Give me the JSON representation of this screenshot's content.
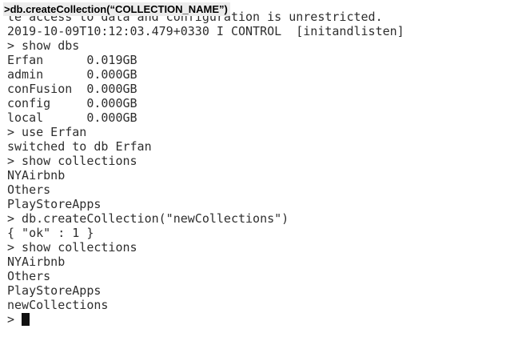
{
  "caption": ">db.createCollection(“COLLECTION_NAME”)",
  "terminal": {
    "lines": [
      "te access to data and configuration is unrestricted.",
      "2019-10-09T10:12:03.479+0330 I CONTROL  [initandlisten]",
      "> show dbs",
      "Erfan      0.019GB",
      "admin      0.000GB",
      "conFusion  0.000GB",
      "config     0.000GB",
      "local      0.000GB",
      "> use Erfan",
      "switched to db Erfan",
      "> show collections",
      "NYAirbnb",
      "Others",
      "PlayStoreApps",
      "> db.createCollection(\"newCollections\")",
      "{ \"ok\" : 1 }",
      "> show collections",
      "NYAirbnb",
      "Others",
      "PlayStoreApps",
      "newCollections"
    ],
    "prompt": ">"
  }
}
